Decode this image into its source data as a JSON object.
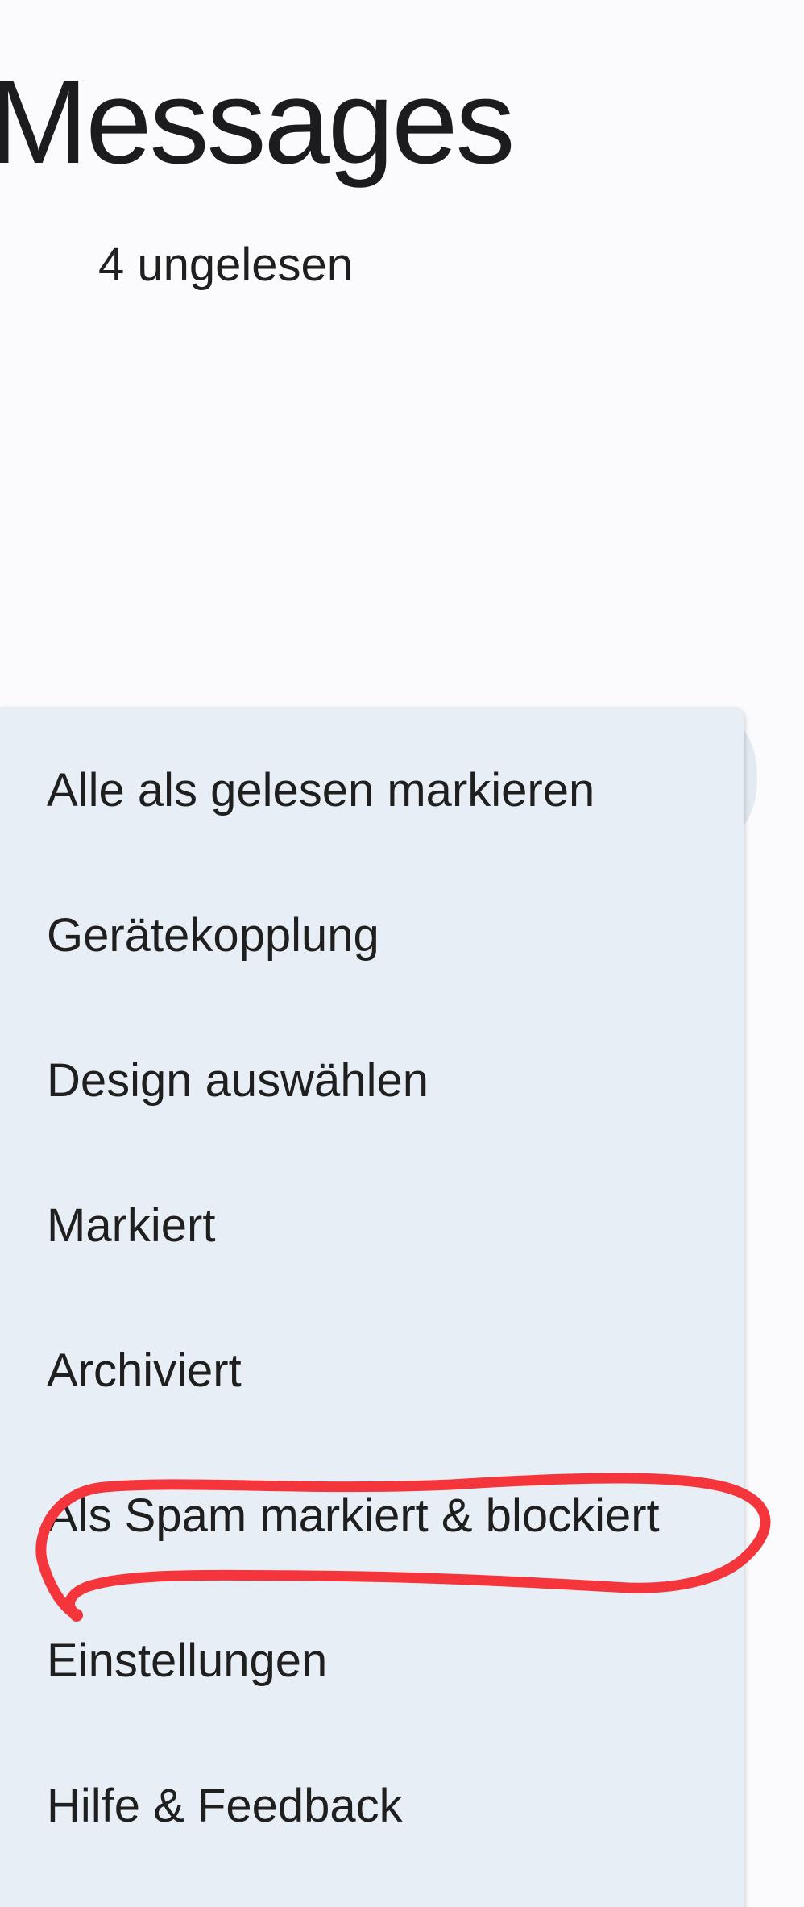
{
  "header": {
    "title": "Messages",
    "unread": "4 ungelesen"
  },
  "menu": {
    "items": [
      {
        "label": "Alle als gelesen markieren"
      },
      {
        "label": "Gerätekopplung"
      },
      {
        "label": "Design auswählen"
      },
      {
        "label": "Markiert"
      },
      {
        "label": "Archiviert"
      },
      {
        "label": "Als Spam markiert & blockiert"
      },
      {
        "label": "Einstellungen"
      },
      {
        "label": "Hilfe & Feedback"
      }
    ]
  },
  "colors": {
    "background": "#fbfbfd",
    "menu_background": "#e8eef5",
    "text": "#1f1f1f",
    "annotation_stroke": "#f5353c"
  }
}
